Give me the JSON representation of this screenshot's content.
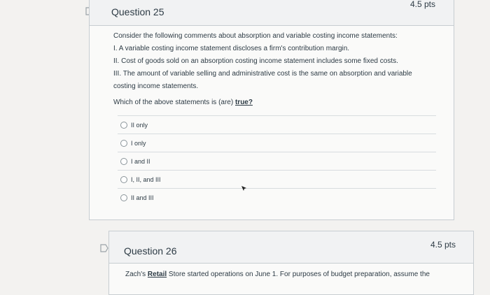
{
  "question25": {
    "title": "Question 25",
    "points": "4.5 pts",
    "text_intro": "Consider the following comments about absorption and variable costing income statements:",
    "statement_1": "I.  A variable costing income statement discloses a firm's contribution margin.",
    "statement_2": "II.  Cost of goods sold on an absorption costing income statement includes some fixed costs.",
    "statement_3a": "III.  The amount of variable selling and administrative cost is the same on absorption and variable",
    "statement_3b": "costing income statements.",
    "prompt_before": "Which of the above statements is (are) ",
    "prompt_emphasis": "true?",
    "answers": [
      "II only",
      "I only",
      "I and II",
      "I, II, and III",
      "II and III"
    ]
  },
  "question26": {
    "title": "Question 26",
    "points": "4.5 pts",
    "text_before": "Zach's ",
    "text_emphasis": "Retail",
    "text_after": " Store started operations on June 1.  For purposes of budget preparation, assume the"
  },
  "colors": {
    "page_background": "#f3f2f0",
    "card_background": "#fafaf9",
    "header_background": "#f1f2f3",
    "text": "#2d3b45"
  },
  "icons": [
    "flag-icon",
    "radio-icon",
    "mouse-cursor-icon"
  ]
}
